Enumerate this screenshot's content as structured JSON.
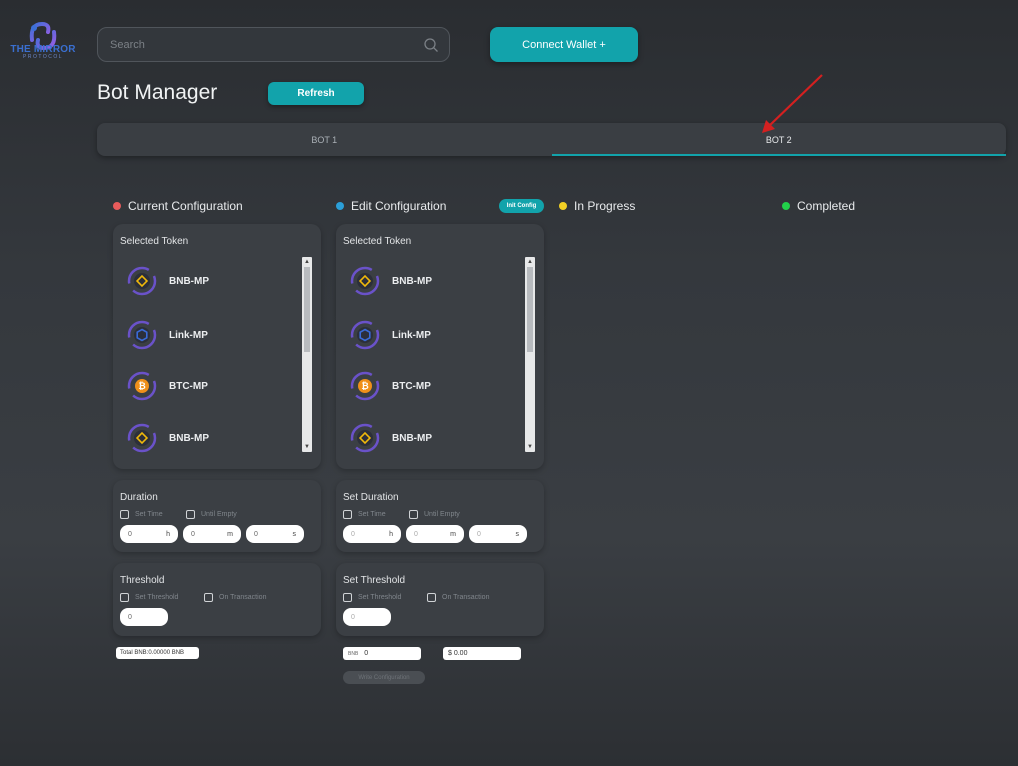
{
  "brand": {
    "name": "THE MIRROR",
    "sub": "PROTOCOL"
  },
  "search": {
    "placeholder": "Search"
  },
  "header": {
    "connect_label": "Connect Wallet +"
  },
  "page": {
    "title": "Bot Manager",
    "refresh_label": "Refresh"
  },
  "tabs": [
    {
      "label": "BOT 1",
      "active": false
    },
    {
      "label": "BOT 2",
      "active": true
    }
  ],
  "columns": {
    "current": {
      "label": "Current Configuration",
      "color": "#e85b5b"
    },
    "edit": {
      "label": "Edit Configuration",
      "color": "#2b9fd8",
      "init_label": "Init Config"
    },
    "progress": {
      "label": "In Progress",
      "color": "#f2d024"
    },
    "completed": {
      "label": "Completed",
      "color": "#22d14a"
    }
  },
  "current": {
    "tokens_title": "Selected Token",
    "tokens": [
      {
        "name": "BNB-MP",
        "icon": "bnb-icon"
      },
      {
        "name": "Link-MP",
        "icon": "chainlink-icon"
      },
      {
        "name": "BTC-MP",
        "icon": "bitcoin-icon"
      },
      {
        "name": "BNB-MP",
        "icon": "bnb-icon"
      }
    ],
    "duration_title": "Duration",
    "opt_set_time": "Set Time",
    "opt_until_empty": "Until Empty",
    "hours": "0",
    "minutes": "0",
    "seconds": "0",
    "unit_h": "h",
    "unit_m": "m",
    "unit_s": "s",
    "threshold_title": "Threshold",
    "opt_set_threshold": "Set Threshold",
    "opt_on_transaction": "On Transaction",
    "threshold_value": "0",
    "total": "Total BNB:0.00000 BNB"
  },
  "edit": {
    "tokens_title": "Selected Token",
    "tokens": [
      {
        "name": "BNB-MP",
        "icon": "bnb-icon"
      },
      {
        "name": "Link-MP",
        "icon": "chainlink-icon"
      },
      {
        "name": "BTC-MP",
        "icon": "bitcoin-icon"
      },
      {
        "name": "BNB-MP",
        "icon": "bnb-icon"
      }
    ],
    "duration_title": "Set Duration",
    "opt_set_time": "Set Time",
    "opt_until_empty": "Until Empty",
    "hours": "0",
    "minutes": "0",
    "seconds": "0",
    "unit_h": "h",
    "unit_m": "m",
    "unit_s": "s",
    "threshold_title": "Set Threshold",
    "opt_set_threshold": "Set Threshold",
    "opt_on_transaction": "On Transaction",
    "threshold_value": "0",
    "bnb_label": "BNB",
    "bnb_value": "0",
    "usd_value": "$ 0.00",
    "save_label": "Write Configuration"
  }
}
